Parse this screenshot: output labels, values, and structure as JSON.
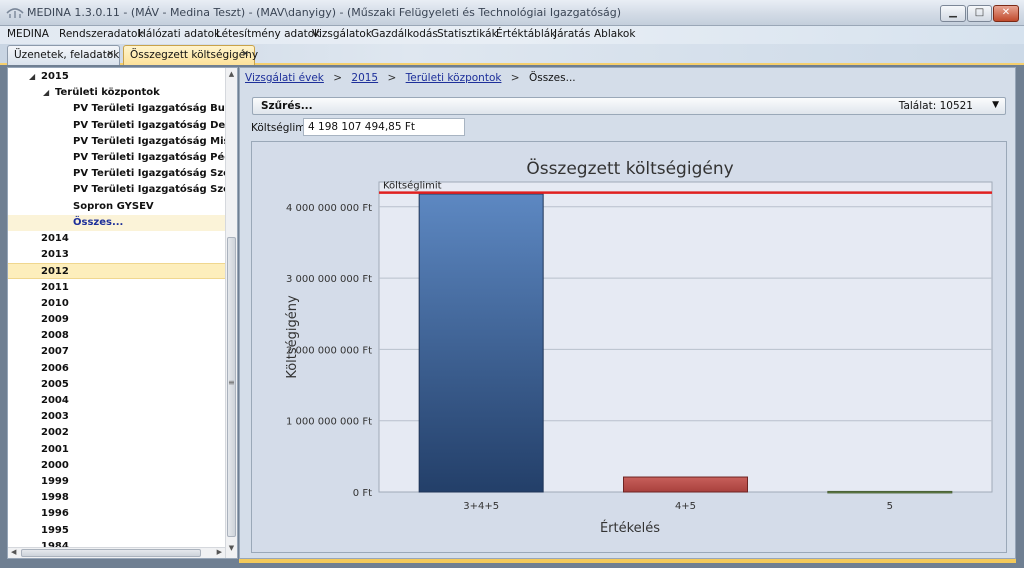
{
  "window": {
    "title": "MEDINA 1.3.0.11 - (MÁV - Medina Teszt) - (MAV\\danyigy) - (Műszaki Felügyeleti és Technológiai Igazgatóság)",
    "buttons": {
      "minimize": "▁",
      "maximize": "□",
      "close": "✕"
    }
  },
  "menu": [
    "MEDINA",
    "Rendszeradatok",
    "Hálózati adatok",
    "Létesítmény adatok",
    "Vizsgálatok",
    "Gazdálkodás",
    "Statisztikák",
    "Értéktáblák",
    "Járatás",
    "Ablakok"
  ],
  "tabs": [
    {
      "label": "Üzenetek, feladatok",
      "close": "×"
    },
    {
      "label": "Összegzett költségigény",
      "close": "×"
    }
  ],
  "tree": {
    "rows": [
      {
        "label": "2015",
        "arrow": "◢",
        "level": 0
      },
      {
        "label": "Területi központok",
        "arrow": "◢",
        "level": 1
      },
      {
        "label": "PV Területi Igazgatóság Budapest",
        "level": 2
      },
      {
        "label": "PV Területi Igazgatóság Debrecen",
        "level": 2
      },
      {
        "label": "PV Területi Igazgatóság Miskolc",
        "level": 2
      },
      {
        "label": "PV Területi Igazgatóság Pécs",
        "level": 2
      },
      {
        "label": "PV Területi Igazgatóság Szeged",
        "level": 2
      },
      {
        "label": "PV Területi Igazgatóság Szombathely",
        "level": 2
      },
      {
        "label": "Sopron GYSEV",
        "level": 2
      },
      {
        "label": "Összes...",
        "level": 2,
        "state": "hover"
      },
      {
        "label": "2014",
        "level": 0
      },
      {
        "label": "2013",
        "level": 0
      },
      {
        "label": "2012",
        "level": 0,
        "state": "selected"
      },
      {
        "label": "2011",
        "level": 0
      },
      {
        "label": "2010",
        "level": 0
      },
      {
        "label": "2009",
        "level": 0
      },
      {
        "label": "2008",
        "level": 0
      },
      {
        "label": "2007",
        "level": 0
      },
      {
        "label": "2006",
        "level": 0
      },
      {
        "label": "2005",
        "level": 0
      },
      {
        "label": "2004",
        "level": 0
      },
      {
        "label": "2003",
        "level": 0
      },
      {
        "label": "2002",
        "level": 0
      },
      {
        "label": "2001",
        "level": 0
      },
      {
        "label": "2000",
        "level": 0
      },
      {
        "label": "1999",
        "level": 0
      },
      {
        "label": "1998",
        "level": 0
      },
      {
        "label": "1996",
        "level": 0
      },
      {
        "label": "1995",
        "level": 0
      },
      {
        "label": "1984",
        "level": 0
      }
    ],
    "scroll_grip": "≡"
  },
  "breadcrumb": {
    "items": [
      "Vizsgálati évek",
      "2015",
      "Területi központok"
    ],
    "current": "Összes...",
    "separator": ">"
  },
  "filter": {
    "label": "Szűrés...",
    "hits": "Találat: 10521",
    "arrow": "▼"
  },
  "limit": {
    "label": "Költséglimit",
    "value": "4 198 107 494,85 Ft"
  },
  "colors": {
    "bar_blue_top": "#5d88c2",
    "bar_blue_bottom": "#233f69",
    "bar_red": "#a8403d",
    "bar_green": "#6b8a4f",
    "limit_line": "#e02020",
    "accent_tab": "#fde29a"
  },
  "chart_data": {
    "type": "bar",
    "title": "Összegzett költségigény",
    "xlabel": "Értékelés",
    "ylabel": "Költségigény",
    "categories": [
      "3+4+5",
      "4+5",
      "5"
    ],
    "values": [
      4180000000,
      210000000,
      8000000
    ],
    "ylim": [
      0,
      4500000000
    ],
    "yticks": [
      0,
      1000000000,
      2000000000,
      3000000000,
      4000000000
    ],
    "ytick_labels": [
      "0 Ft",
      "1 000 000 000 Ft",
      "2 000 000 000 Ft",
      "3 000 000 000 Ft",
      "4 000 000 000 Ft"
    ],
    "limit_line": {
      "label": "Költséglimit",
      "value": 4198107494.85
    },
    "grid": true
  }
}
